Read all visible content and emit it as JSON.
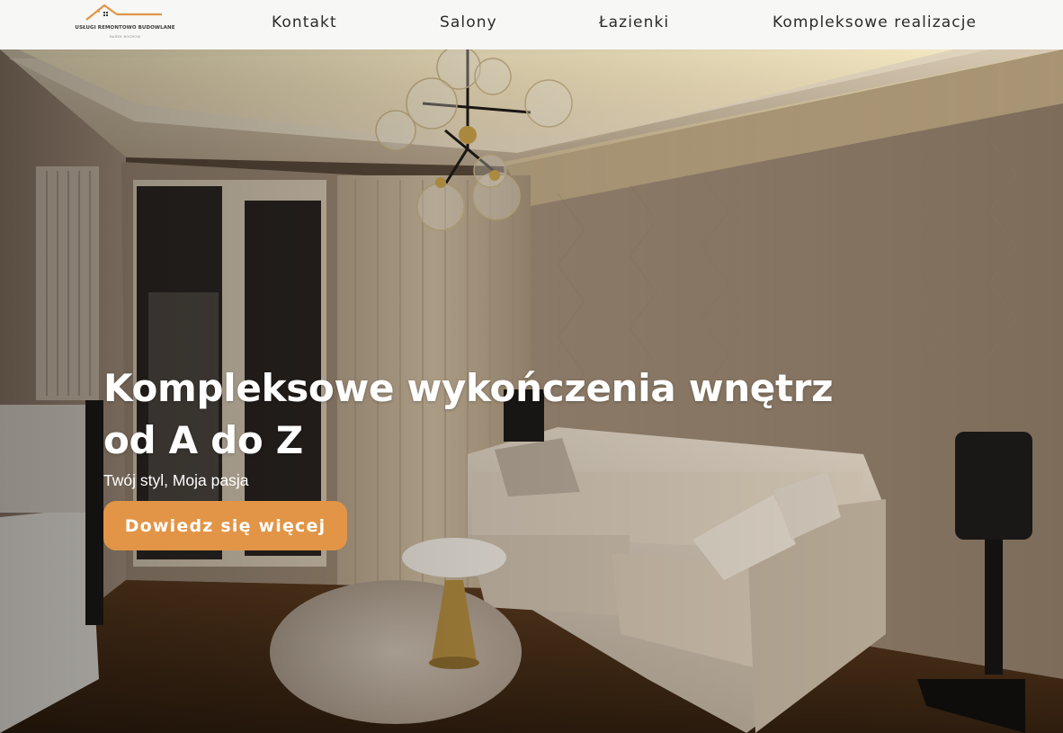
{
  "brand": {
    "name": "USŁUGI REMONTOWO BUDOWLANE",
    "subtitle": "MAREK BOGROW",
    "accent_color": "#e29546",
    "icon": "house-roof-logo-icon"
  },
  "nav": {
    "items": [
      {
        "label": "Kontakt"
      },
      {
        "label": "Salony"
      },
      {
        "label": "Łazienki"
      },
      {
        "label": "Kompleksowe realizacje"
      }
    ]
  },
  "hero": {
    "title": "Kompleksowe wykończenia wnętrz od A do Z",
    "subtitle": "Twój styl, Moja pasja",
    "cta_label": "Dowiedz się więcej",
    "background": "living-room-photo"
  }
}
